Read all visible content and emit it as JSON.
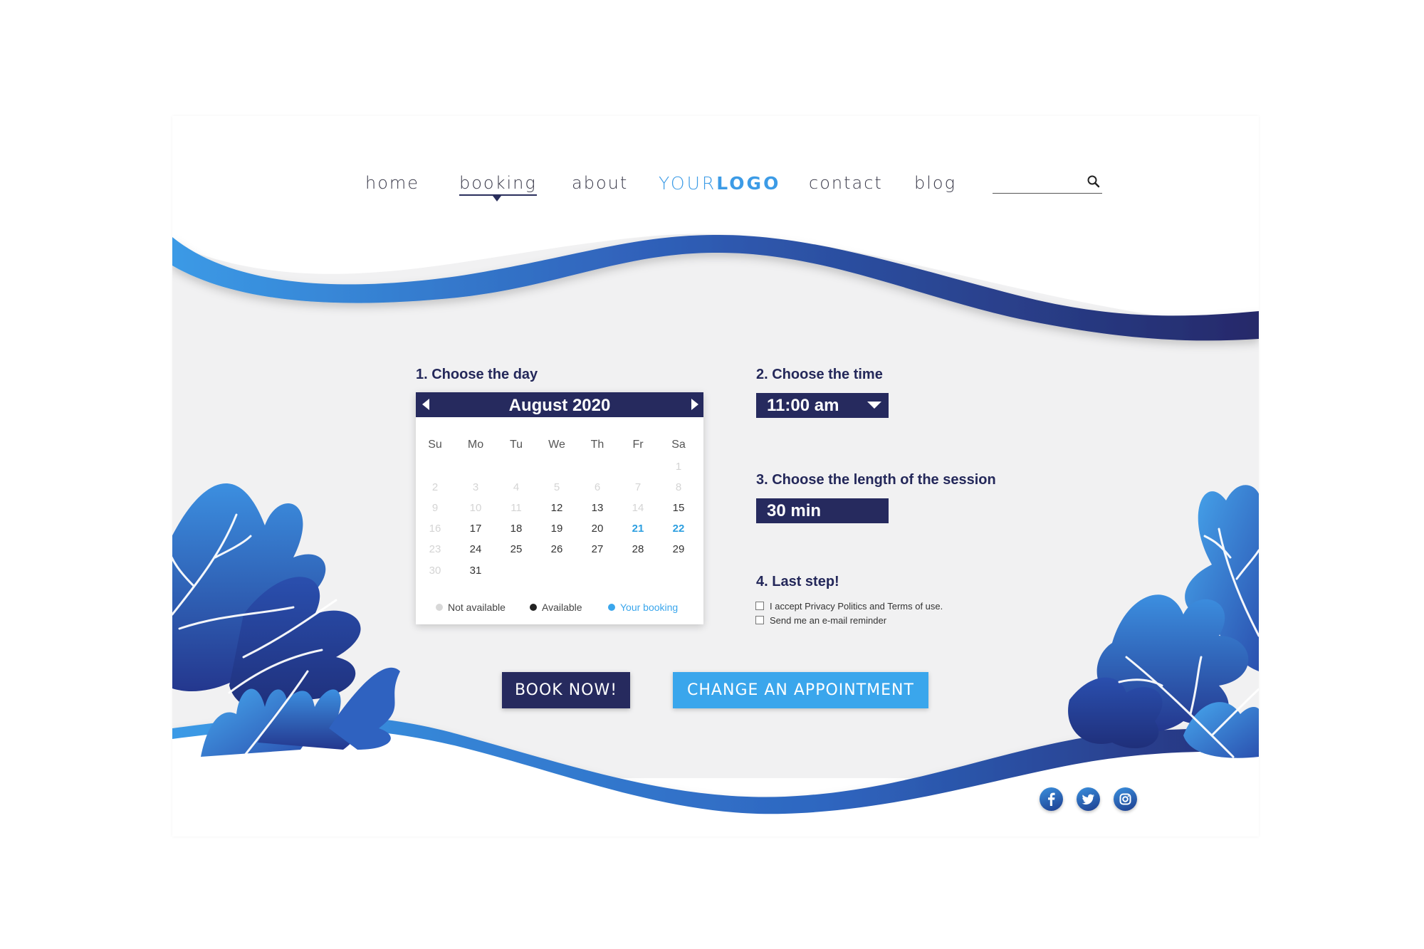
{
  "nav": {
    "links": [
      "home",
      "booking",
      "about",
      "contact",
      "blog"
    ],
    "logo_light": "YOUR",
    "logo_bold": "LOGO",
    "search_placeholder": ""
  },
  "booking": {
    "step1_title": "1. Choose the day",
    "step2_title": "2. Choose the time",
    "step3_title": "3. Choose the length of the session",
    "step4_title": "4. Last step!",
    "calendar": {
      "month": "August 2020",
      "weekdays": [
        "Su",
        "Mo",
        "Tu",
        "We",
        "Th",
        "Fr",
        "Sa"
      ],
      "days": [
        {
          "d": "1",
          "s": "na"
        },
        {
          "d": "2",
          "s": "na"
        },
        {
          "d": "3",
          "s": "na"
        },
        {
          "d": "4",
          "s": "na"
        },
        {
          "d": "5",
          "s": "na"
        },
        {
          "d": "6",
          "s": "na"
        },
        {
          "d": "7",
          "s": "na"
        },
        {
          "d": "8",
          "s": "na"
        },
        {
          "d": "9",
          "s": "na"
        },
        {
          "d": "10",
          "s": "na"
        },
        {
          "d": "11",
          "s": "na"
        },
        {
          "d": "12",
          "s": "av"
        },
        {
          "d": "13",
          "s": "av"
        },
        {
          "d": "14",
          "s": "na"
        },
        {
          "d": "15",
          "s": "av"
        },
        {
          "d": "16",
          "s": "na"
        },
        {
          "d": "17",
          "s": "av"
        },
        {
          "d": "18",
          "s": "av"
        },
        {
          "d": "19",
          "s": "av"
        },
        {
          "d": "20",
          "s": "av"
        },
        {
          "d": "21",
          "s": "booked"
        },
        {
          "d": "22",
          "s": "booked"
        },
        {
          "d": "23",
          "s": "na"
        },
        {
          "d": "24",
          "s": "av"
        },
        {
          "d": "25",
          "s": "av"
        },
        {
          "d": "26",
          "s": "av"
        },
        {
          "d": "27",
          "s": "av"
        },
        {
          "d": "28",
          "s": "av"
        },
        {
          "d": "29",
          "s": "av"
        },
        {
          "d": "30",
          "s": "na"
        },
        {
          "d": "31",
          "s": "av"
        }
      ],
      "legend": [
        "Not available",
        "Available",
        "Your booking"
      ]
    },
    "time_value": "11:00 am",
    "length_value": "30 min",
    "checkboxes": [
      "I accept Privacy Politics and Terms of use.",
      "Send me an e-mail reminder"
    ],
    "book_button": "BOOK NOW!",
    "change_button": "CHANGE AN APPOINTMENT"
  },
  "social": [
    "facebook-icon",
    "twitter-icon",
    "instagram-icon"
  ],
  "colors": {
    "navy": "#262a5e",
    "accent_blue": "#3aa6ec",
    "booked_blue": "#2d9fe0",
    "panel_gray": "#f1f1f2"
  }
}
